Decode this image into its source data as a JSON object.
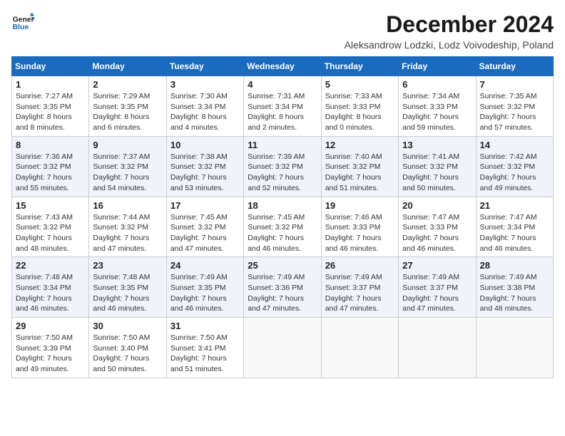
{
  "logo": {
    "line1": "General",
    "line2": "Blue"
  },
  "title": "December 2024",
  "subtitle": "Aleksandrow Lodzki, Lodz Voivodeship, Poland",
  "days_of_week": [
    "Sunday",
    "Monday",
    "Tuesday",
    "Wednesday",
    "Thursday",
    "Friday",
    "Saturday"
  ],
  "weeks": [
    [
      {
        "day": "1",
        "sunrise": "7:27 AM",
        "sunset": "3:35 PM",
        "daylight": "8 hours and 8 minutes."
      },
      {
        "day": "2",
        "sunrise": "7:29 AM",
        "sunset": "3:35 PM",
        "daylight": "8 hours and 6 minutes."
      },
      {
        "day": "3",
        "sunrise": "7:30 AM",
        "sunset": "3:34 PM",
        "daylight": "8 hours and 4 minutes."
      },
      {
        "day": "4",
        "sunrise": "7:31 AM",
        "sunset": "3:34 PM",
        "daylight": "8 hours and 2 minutes."
      },
      {
        "day": "5",
        "sunrise": "7:33 AM",
        "sunset": "3:33 PM",
        "daylight": "8 hours and 0 minutes."
      },
      {
        "day": "6",
        "sunrise": "7:34 AM",
        "sunset": "3:33 PM",
        "daylight": "7 hours and 59 minutes."
      },
      {
        "day": "7",
        "sunrise": "7:35 AM",
        "sunset": "3:32 PM",
        "daylight": "7 hours and 57 minutes."
      }
    ],
    [
      {
        "day": "8",
        "sunrise": "7:36 AM",
        "sunset": "3:32 PM",
        "daylight": "7 hours and 55 minutes."
      },
      {
        "day": "9",
        "sunrise": "7:37 AM",
        "sunset": "3:32 PM",
        "daylight": "7 hours and 54 minutes."
      },
      {
        "day": "10",
        "sunrise": "7:38 AM",
        "sunset": "3:32 PM",
        "daylight": "7 hours and 53 minutes."
      },
      {
        "day": "11",
        "sunrise": "7:39 AM",
        "sunset": "3:32 PM",
        "daylight": "7 hours and 52 minutes."
      },
      {
        "day": "12",
        "sunrise": "7:40 AM",
        "sunset": "3:32 PM",
        "daylight": "7 hours and 51 minutes."
      },
      {
        "day": "13",
        "sunrise": "7:41 AM",
        "sunset": "3:32 PM",
        "daylight": "7 hours and 50 minutes."
      },
      {
        "day": "14",
        "sunrise": "7:42 AM",
        "sunset": "3:32 PM",
        "daylight": "7 hours and 49 minutes."
      }
    ],
    [
      {
        "day": "15",
        "sunrise": "7:43 AM",
        "sunset": "3:32 PM",
        "daylight": "7 hours and 48 minutes."
      },
      {
        "day": "16",
        "sunrise": "7:44 AM",
        "sunset": "3:32 PM",
        "daylight": "7 hours and 47 minutes."
      },
      {
        "day": "17",
        "sunrise": "7:45 AM",
        "sunset": "3:32 PM",
        "daylight": "7 hours and 47 minutes."
      },
      {
        "day": "18",
        "sunrise": "7:45 AM",
        "sunset": "3:32 PM",
        "daylight": "7 hours and 46 minutes."
      },
      {
        "day": "19",
        "sunrise": "7:46 AM",
        "sunset": "3:33 PM",
        "daylight": "7 hours and 46 minutes."
      },
      {
        "day": "20",
        "sunrise": "7:47 AM",
        "sunset": "3:33 PM",
        "daylight": "7 hours and 46 minutes."
      },
      {
        "day": "21",
        "sunrise": "7:47 AM",
        "sunset": "3:34 PM",
        "daylight": "7 hours and 46 minutes."
      }
    ],
    [
      {
        "day": "22",
        "sunrise": "7:48 AM",
        "sunset": "3:34 PM",
        "daylight": "7 hours and 46 minutes."
      },
      {
        "day": "23",
        "sunrise": "7:48 AM",
        "sunset": "3:35 PM",
        "daylight": "7 hours and 46 minutes."
      },
      {
        "day": "24",
        "sunrise": "7:49 AM",
        "sunset": "3:35 PM",
        "daylight": "7 hours and 46 minutes."
      },
      {
        "day": "25",
        "sunrise": "7:49 AM",
        "sunset": "3:36 PM",
        "daylight": "7 hours and 47 minutes."
      },
      {
        "day": "26",
        "sunrise": "7:49 AM",
        "sunset": "3:37 PM",
        "daylight": "7 hours and 47 minutes."
      },
      {
        "day": "27",
        "sunrise": "7:49 AM",
        "sunset": "3:37 PM",
        "daylight": "7 hours and 47 minutes."
      },
      {
        "day": "28",
        "sunrise": "7:49 AM",
        "sunset": "3:38 PM",
        "daylight": "7 hours and 48 minutes."
      }
    ],
    [
      {
        "day": "29",
        "sunrise": "7:50 AM",
        "sunset": "3:39 PM",
        "daylight": "7 hours and 49 minutes."
      },
      {
        "day": "30",
        "sunrise": "7:50 AM",
        "sunset": "3:40 PM",
        "daylight": "7 hours and 50 minutes."
      },
      {
        "day": "31",
        "sunrise": "7:50 AM",
        "sunset": "3:41 PM",
        "daylight": "7 hours and 51 minutes."
      },
      null,
      null,
      null,
      null
    ]
  ],
  "labels": {
    "sunrise": "Sunrise:",
    "sunset": "Sunset:",
    "daylight": "Daylight:"
  }
}
